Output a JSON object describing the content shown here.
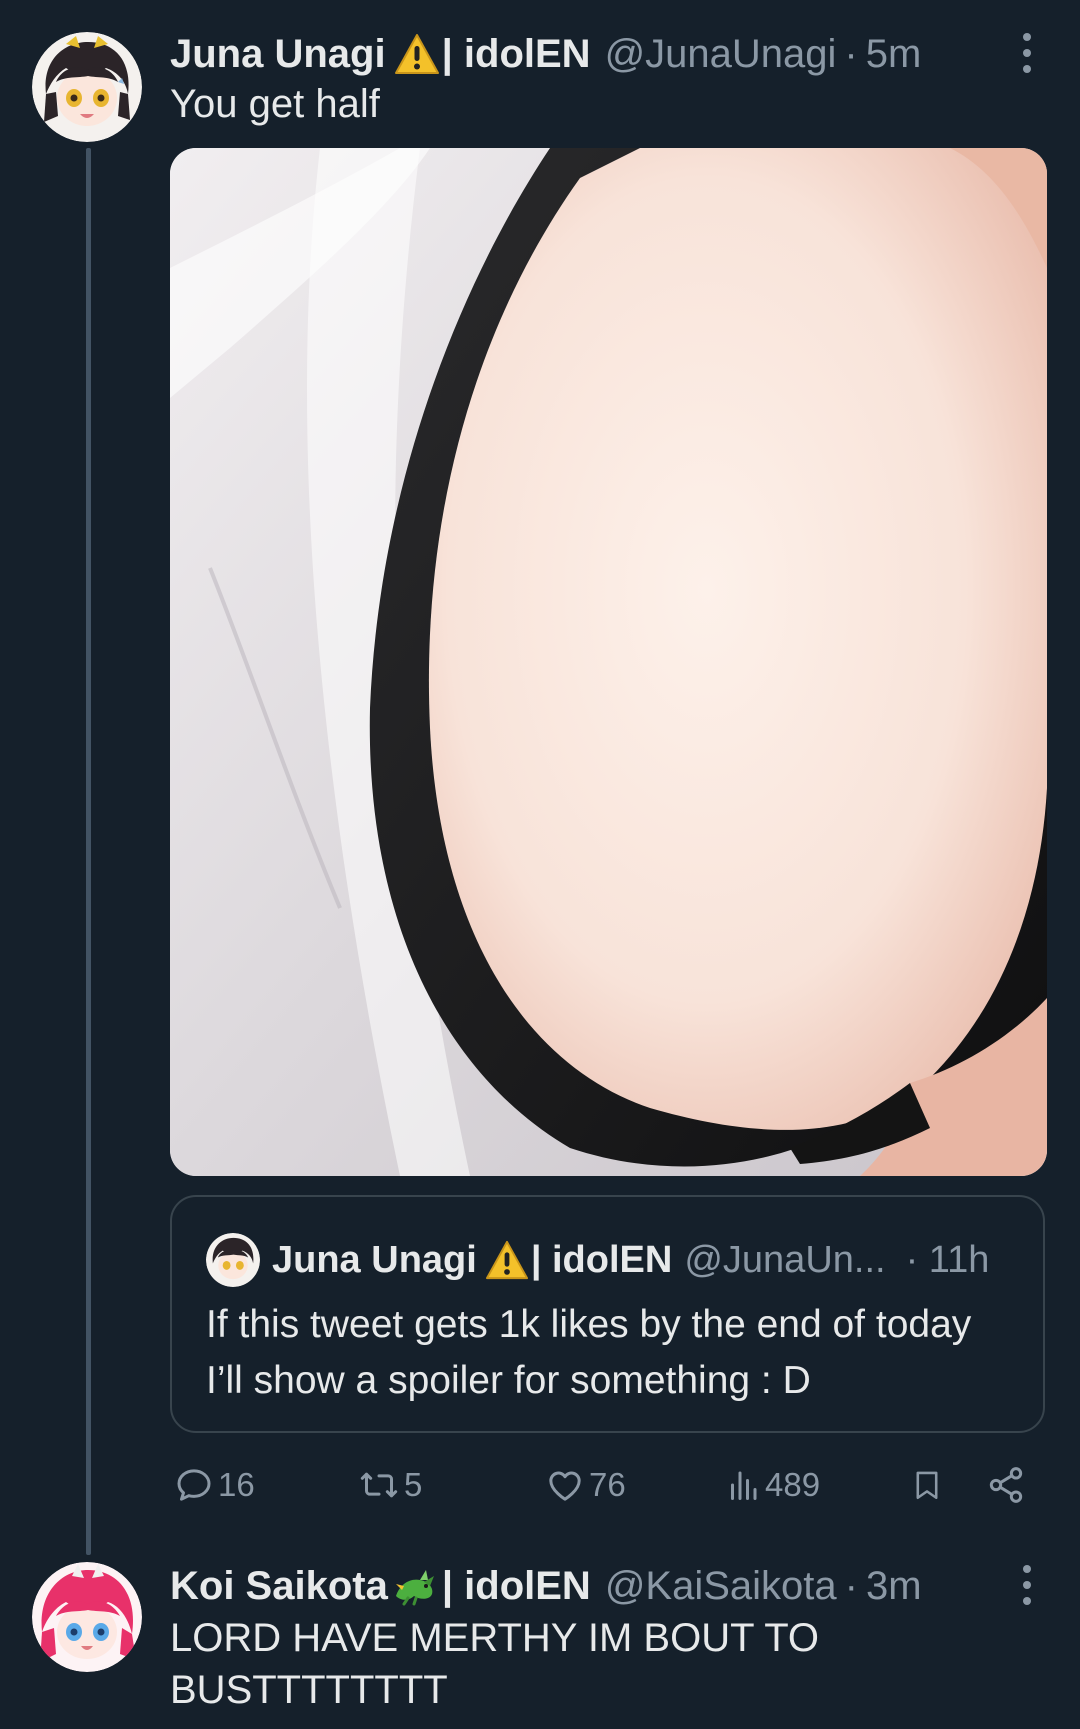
{
  "thread": {
    "main_tweet": {
      "display_name": "Juna Unagi",
      "warning_emoji": "warning-sign-emoji",
      "badge": "| idolEN",
      "handle": "@JunaUnagi",
      "separator": "·",
      "time": "5m",
      "text": "You get half",
      "media": "image",
      "quoted_tweet": {
        "display_name": "Juna Unagi",
        "badge": "| idolEN",
        "handle": "@JunaUn...",
        "time": "· 11h",
        "text": "If this tweet gets 1k likes by the end of today I’ll show a spoiler for something : D"
      },
      "actions": {
        "replies": "16",
        "retweets": "5",
        "likes": "76",
        "views": "489"
      }
    },
    "reply_tweet": {
      "display_name": "Koi Saikota",
      "emoji": "dragon-emoji",
      "badge": "| idolEN",
      "handle": "@KaiSaikota",
      "separator": "·",
      "time": "3m",
      "text": "LORD HAVE MERTHY IM BOUT TO BUSTTTTTTTT"
    }
  },
  "colors": {
    "background": "#15202b",
    "text_primary": "#e7e9ea",
    "text_secondary": "#8b98a5",
    "border": "#38444d",
    "thread_line": "#425364"
  }
}
